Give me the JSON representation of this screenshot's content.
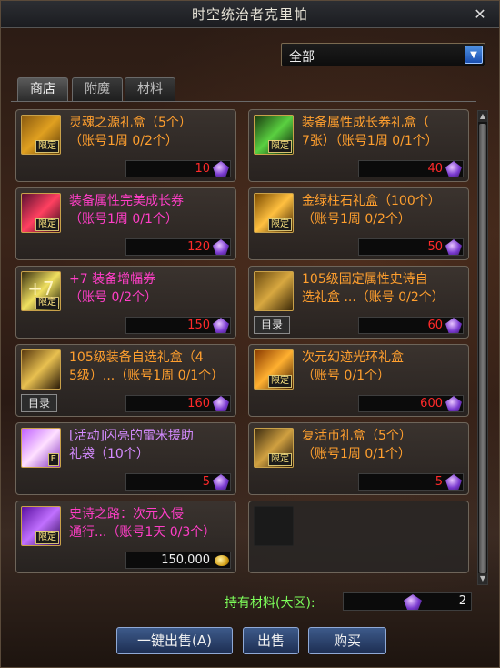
{
  "window": {
    "title": "时空统治者克里帕",
    "close_icon": "close-icon"
  },
  "filter": {
    "value": "全部",
    "arrow_icon": "chevron-down-icon"
  },
  "tabs": [
    {
      "label": "商店",
      "active": true
    },
    {
      "label": "附魔",
      "active": false
    },
    {
      "label": "材料",
      "active": false
    }
  ],
  "items": [
    {
      "name": "灵魂之源礼盒（5个）\n（账号1周 0/2个）",
      "color": "orange",
      "price": "10",
      "badge": "限定",
      "icon": "gift-box-icon",
      "catalog": ""
    },
    {
      "name": "装备属性成长券礼盒（\n7张）（账号1周 0/1个）",
      "color": "orange",
      "price": "40",
      "badge": "限定",
      "icon": "ticket-icon",
      "catalog": ""
    },
    {
      "name": "装备属性完美成长券\n（账号1周 0/1个）",
      "color": "magenta",
      "price": "120",
      "badge": "限定",
      "icon": "ticket-icon",
      "catalog": ""
    },
    {
      "name": "金绿柱石礼盒（100个）\n（账号1周 0/2个）",
      "color": "orange",
      "price": "50",
      "badge": "限定",
      "icon": "gem-icon",
      "catalog": ""
    },
    {
      "name": "+7 装备增幅券\n（账号 0/2个）",
      "color": "magenta",
      "price": "150",
      "badge": "限定",
      "icon": "amplify-ticket-icon",
      "glyph": "+7",
      "catalog": ""
    },
    {
      "name": "105级固定属性史诗自\n选礼盒 ...（账号 0/2个）",
      "color": "orange",
      "price": "60",
      "badge": "",
      "icon": "chest-icon",
      "catalog": "目录"
    },
    {
      "name": "105级装备自选礼盒（4\n5级）...（账号1周 0/1个）",
      "color": "orange",
      "price": "160",
      "badge": "",
      "icon": "chest-icon",
      "catalog": "目录"
    },
    {
      "name": "次元幻迹光环礼盒\n（账号 0/1个）",
      "color": "orange",
      "price": "600",
      "badge": "限定",
      "icon": "aura-box-icon",
      "catalog": ""
    },
    {
      "name": "[活动]闪亮的雷米援助\n礼袋（10个）",
      "color": "purple",
      "price": "5",
      "badge": "E",
      "icon": "gift-bag-icon",
      "catalog": ""
    },
    {
      "name": "复活币礼盒（5个）\n（账号1周 0/1个）",
      "color": "orange",
      "price": "5",
      "badge": "限定",
      "icon": "coin-box-icon",
      "catalog": ""
    },
    {
      "name": "史诗之路：次元入侵\n通行...（账号1天 0/3个）",
      "color": "magenta",
      "price": "150,000",
      "badge": "限定",
      "icon": "pass-ticket-icon",
      "catalog": "",
      "gold": true
    }
  ],
  "materials": {
    "label": "持有材料(大区):",
    "count": "2",
    "currency_icon": "purple-crystal-icon"
  },
  "buttons": {
    "sell_all": "一键出售(A)",
    "sell": "出售",
    "buy": "购买"
  },
  "colors": {
    "orange": "#ff9f2e",
    "magenta": "#ff3ec7",
    "purple": "#d58bff",
    "price_red": "#ff2a2a",
    "materials_green": "#7dff5a"
  }
}
